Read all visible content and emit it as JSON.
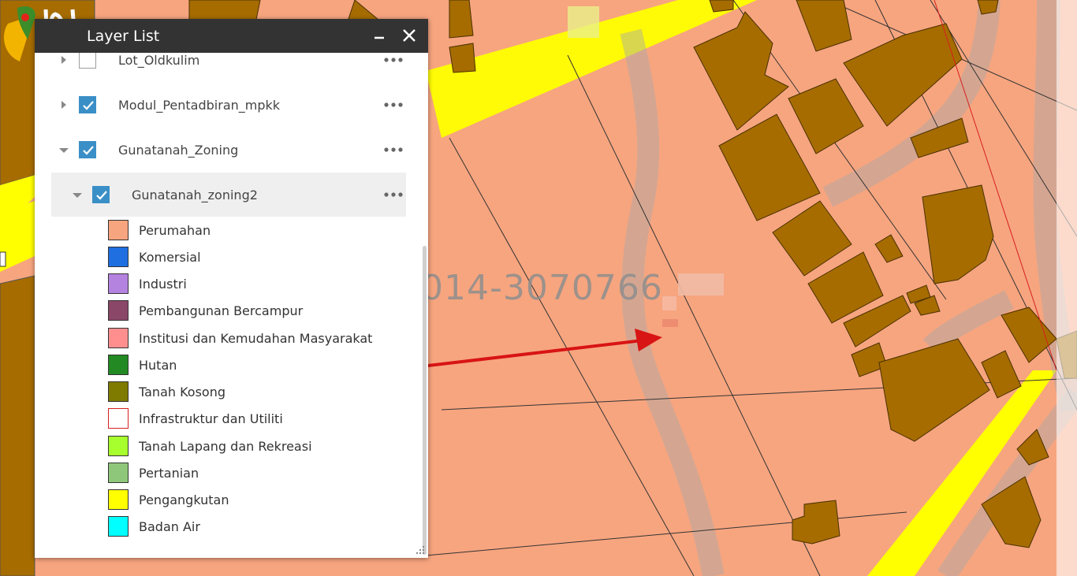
{
  "panel": {
    "title": "Layer List",
    "header_color": "#333333",
    "minimize_icon": "minimize-icon",
    "close_icon": "close-icon"
  },
  "layers": [
    {
      "name": "Lot_Oldkulim",
      "checked": false,
      "expanded": false
    },
    {
      "name": "Modul_Pentadbiran_mpkk",
      "checked": true,
      "expanded": false
    },
    {
      "name": "Gunatanah_Zoning",
      "checked": true,
      "expanded": true
    },
    {
      "name": "Gunatanah_zoning2",
      "checked": true,
      "expanded": true
    }
  ],
  "legend": [
    {
      "label": "Perumahan",
      "color": "#f7a57f"
    },
    {
      "label": "Komersial",
      "color": "#1f6fe0"
    },
    {
      "label": "Industri",
      "color": "#b483e0"
    },
    {
      "label": "Pembangunan Bercampur",
      "color": "#8a4767"
    },
    {
      "label": "Institusi dan Kemudahan Masyarakat",
      "color": "#ff8f8f"
    },
    {
      "label": "Hutan",
      "color": "#238a23"
    },
    {
      "label": "Tanah Kosong",
      "color": "#7f7a00"
    },
    {
      "label": "Infrastruktur dan Utiliti",
      "color": "#ffffff",
      "outline": "#d61f1f"
    },
    {
      "label": "Tanah Lapang dan Rekreasi",
      "color": "#a8ff2e"
    },
    {
      "label": "Pertanian",
      "color": "#8fc77a"
    },
    {
      "label": "Pengangkutan",
      "color": "#ffff00"
    },
    {
      "label": "Badan Air",
      "color": "#00ffff"
    }
  ],
  "map": {
    "watermark": "014-3070766",
    "colors": {
      "residential": "#f7a57f",
      "building": "#a66c00",
      "road": "#ffff00",
      "tanah_kosong": "#8b6200",
      "arrow": "#d81414"
    }
  }
}
